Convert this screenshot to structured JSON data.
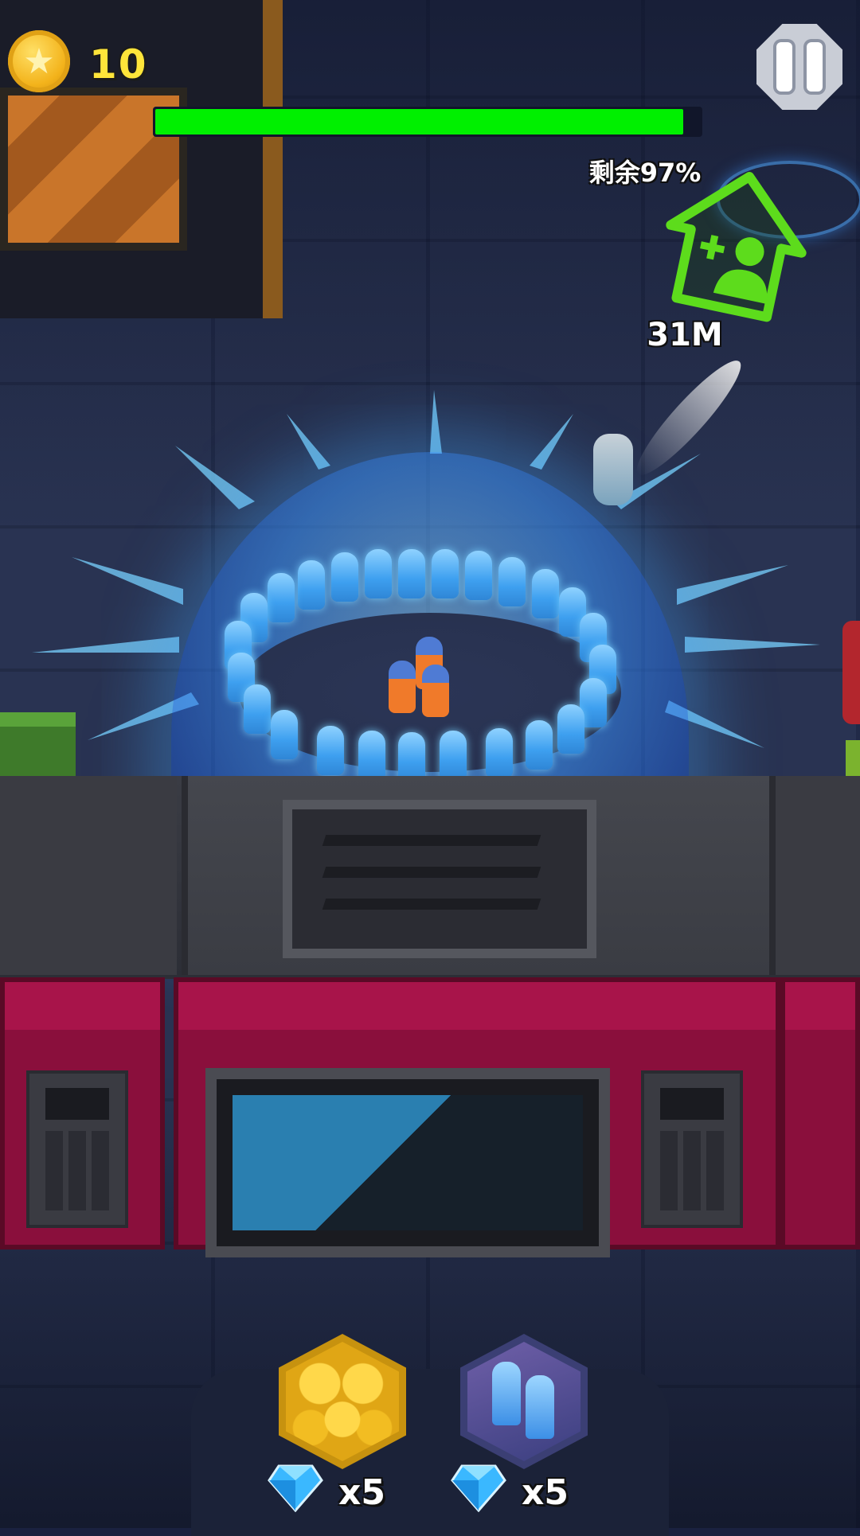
{
  "hud": {
    "coins": "10",
    "remaining_text": "剩余97%",
    "remaining_percent": 97,
    "distance_text": "31M",
    "icons": {
      "coin": "star-coin-icon",
      "pause": "pause-icon",
      "recruit": "add-soldier-house-icon"
    },
    "colors": {
      "progress": "#00f000",
      "coin_text": "#ffe53a",
      "shield": "#3ea0f0"
    }
  },
  "powerups": [
    {
      "name": "honeycomb-shield",
      "icon": "honeycomb-icon",
      "cost_icon": "diamond-icon",
      "cost": "x5"
    },
    {
      "name": "soldier-reinforcement",
      "icon": "soldiers-icon",
      "cost_icon": "diamond-icon",
      "cost": "x5"
    }
  ]
}
